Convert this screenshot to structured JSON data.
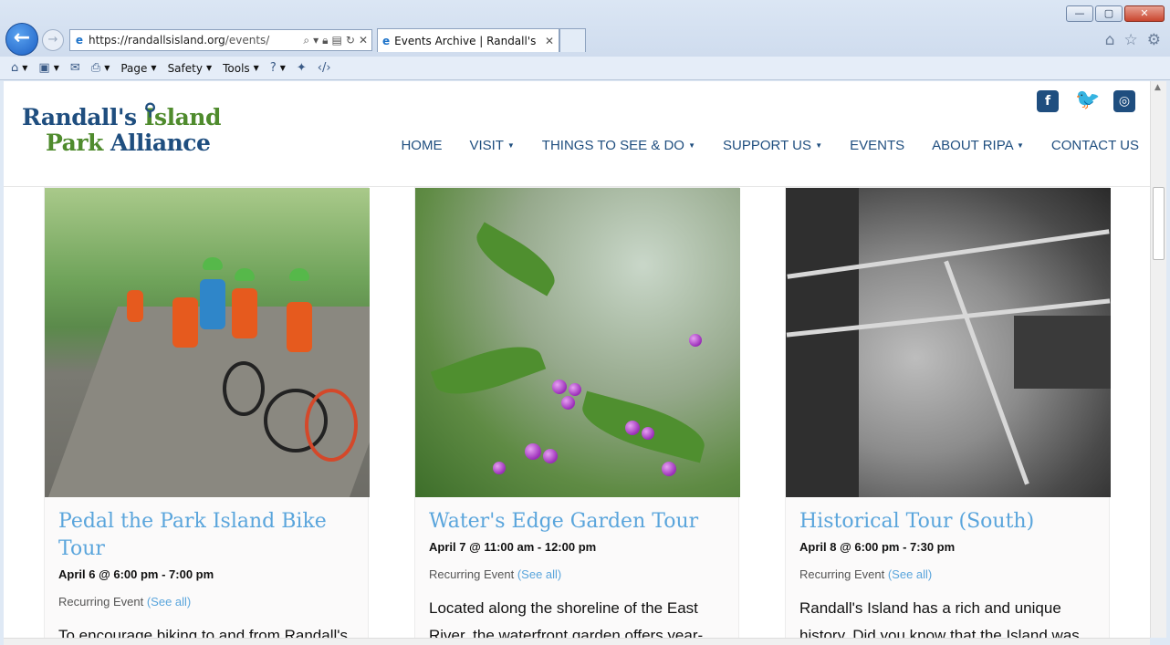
{
  "browser": {
    "url_host": "https://randallsisland.org",
    "url_path": "/events/",
    "tab_title": "Events Archive | Randall's Is...",
    "window_buttons": {
      "minimize": "—",
      "maximize": "▢",
      "close": "✕"
    },
    "command_bar": {
      "page_label": "Page",
      "safety_label": "Safety",
      "tools_label": "Tools"
    }
  },
  "site": {
    "logo_line1_a": "Randall's ",
    "logo_line1_b": "Island",
    "logo_line2_a": "Park ",
    "logo_line2_b": "Alliance",
    "nav": [
      {
        "label": "HOME",
        "dropdown": false
      },
      {
        "label": "VISIT",
        "dropdown": true
      },
      {
        "label": "THINGS TO SEE & DO",
        "dropdown": true
      },
      {
        "label": "SUPPORT US",
        "dropdown": true
      },
      {
        "label": "EVENTS",
        "dropdown": false
      },
      {
        "label": "ABOUT RIPA",
        "dropdown": true
      },
      {
        "label": "CONTACT US",
        "dropdown": false
      }
    ],
    "social": {
      "facebook": "f",
      "twitter": "🐦",
      "instagram": "◎"
    }
  },
  "events": [
    {
      "title": "Pedal the Park Island Bike Tour",
      "date": "April 6 @ 6:00 pm - 7:00 pm",
      "recurring": "Recurring Event",
      "see_all": "(See all)",
      "description": "To encourage biking to and from Randall's"
    },
    {
      "title": "Water's Edge Garden Tour",
      "date": "April 7 @ 11:00 am - 12:00 pm",
      "recurring": "Recurring Event",
      "see_all": "(See all)",
      "description": "Located along the shoreline of the East River, the waterfront garden offers year-"
    },
    {
      "title": "Historical Tour (South)",
      "date": "April 8 @ 6:00 pm - 7:30 pm",
      "recurring": "Recurring Event",
      "see_all": "(See all)",
      "description": "Randall's Island has a rich and unique history. Did you know that the Island was"
    }
  ]
}
